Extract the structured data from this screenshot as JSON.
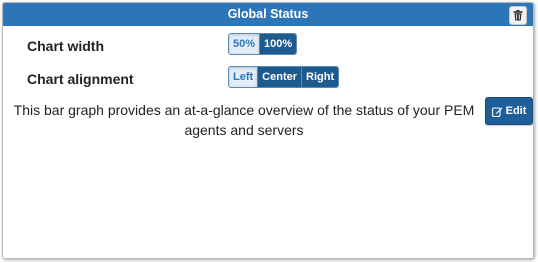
{
  "panel": {
    "title": "Global Status",
    "delete_icon": "trash-icon"
  },
  "settings": {
    "chart_width": {
      "label": "Chart width",
      "options": [
        "50%",
        "100%"
      ],
      "selected": "50%"
    },
    "chart_alignment": {
      "label": "Chart alignment",
      "options": [
        "Left",
        "Center",
        "Right"
      ],
      "selected": "Left"
    }
  },
  "description": "This bar graph provides an at-a-glance overview of the status of your PEM agents and servers",
  "edit_button": {
    "label": "Edit",
    "icon": "edit-icon"
  },
  "colors": {
    "header": "#2c76b8",
    "button": "#1d5a8e",
    "active_segment": "#e3eef8"
  }
}
